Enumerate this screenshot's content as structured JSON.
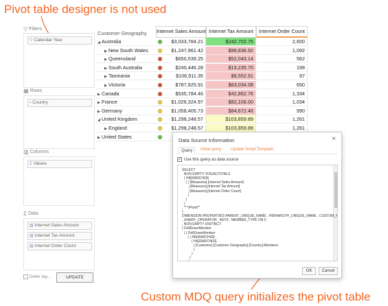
{
  "callouts": {
    "top": "Pivot table designer is not used",
    "bottom": "Custom MDQ query initializes the pivot table",
    "color": "#f26522"
  },
  "designer": {
    "filters": {
      "label": "Filters",
      "chips": [
        "Calendar Year"
      ]
    },
    "rows": {
      "label": "Rows",
      "chips": [
        "Country"
      ]
    },
    "columns": {
      "label": "Columns",
      "chips": [
        "Values"
      ]
    },
    "data": {
      "label": "Data",
      "chips": [
        "Internet Sales Amount",
        "Internet Tax Amount",
        "Internet Order Count"
      ]
    },
    "defer_label": "Defer lay...",
    "update_label": "UPDATE"
  },
  "pivot": {
    "row_header": "Customer Geography",
    "columns": [
      "Internet Sales Amount",
      "Internet Tax Amount",
      "Internet Order Count"
    ],
    "rows": [
      {
        "label": "Australia",
        "level": 0,
        "expanded": true,
        "status": "green",
        "sales": "$3,033,784.21",
        "tax": "$242,702.75",
        "orders": "2,600",
        "tax_color": "#7fe07f"
      },
      {
        "label": "New South Wales",
        "level": 1,
        "expanded": false,
        "status": "yellow",
        "sales": "$1,247,961.42",
        "tax": "$99,836.92",
        "orders": "1,092",
        "tax_color": "#f6c6c6"
      },
      {
        "label": "Queensland",
        "level": 1,
        "expanded": false,
        "status": "red",
        "sales": "$650,539.25",
        "tax": "$52,043.14",
        "orders": "562",
        "tax_color": "#f6c6c6"
      },
      {
        "label": "South Australia",
        "level": 1,
        "expanded": false,
        "status": "red",
        "sales": "$240,446.28",
        "tax": "$19,235.70",
        "orders": "199",
        "tax_color": "#f6c6c6"
      },
      {
        "label": "Tasmania",
        "level": 1,
        "expanded": false,
        "status": "red",
        "sales": "$106,911.35",
        "tax": "$8,552.91",
        "orders": "97",
        "tax_color": "#f6c6c6"
      },
      {
        "label": "Victoria",
        "level": 1,
        "expanded": false,
        "status": "red",
        "sales": "$787,925.91",
        "tax": "$63,034.08",
        "orders": "650",
        "tax_color": "#f6c6c6"
      },
      {
        "label": "Canada",
        "level": 0,
        "expanded": false,
        "status": "red",
        "sales": "$535,784.46",
        "tax": "$42,862.76",
        "orders": "1,334",
        "tax_color": "#f6c6c6"
      },
      {
        "label": "France",
        "level": 0,
        "expanded": false,
        "status": "yellow",
        "sales": "$1,026,324.97",
        "tax": "$82,106.00",
        "orders": "1,034",
        "tax_color": "#f6c6c6"
      },
      {
        "label": "Germany",
        "level": 0,
        "expanded": false,
        "status": "yellow",
        "sales": "$1,058,405.73",
        "tax": "$84,672.46",
        "orders": "990",
        "tax_color": "#f6c6c6"
      },
      {
        "label": "United Kingdom",
        "level": 0,
        "expanded": true,
        "status": "yellow",
        "sales": "$1,298,248.57",
        "tax": "$103,859.89",
        "orders": "1,261",
        "tax_color": "#fafac4"
      },
      {
        "label": "England",
        "level": 1,
        "expanded": false,
        "status": "yellow",
        "sales": "$1,298,248.57",
        "tax": "$103,859.89",
        "orders": "1,261",
        "tax_color": "#fafac4"
      },
      {
        "label": "United States",
        "level": 0,
        "expanded": false,
        "status": "green",
        "sales": "",
        "tax": "",
        "orders": "",
        "tax_color": "#ffffff"
      }
    ],
    "status_colors": {
      "green": "#6cc04a",
      "yellow": "#f2d23c",
      "red": "#e0533d"
    }
  },
  "dialog": {
    "title": "Data Source Information",
    "close_glyph": "×",
    "tabs": [
      "Query",
      "Initial query",
      "Update Script Template"
    ],
    "use_query_label": "Use this query as data source",
    "query_lines": [
      "SELECT",
      "  NON EMPTY VISUALTOTALS",
      "  ( HIERARCHIZE",
      "    ( { [Measures].[Internet Sales Amount]",
      "      , [Measures].[Internet Tax Amount]",
      "      , [Measures].[Internet Order Count]",
      "      }",
      "    )",
      "  )",
      ", \"* VPoint*\"",
      ")",
      "DIMENSION PROPERTIES PARENT_UNIQUE_NAME , HIERARCHY_UNIQUE_NAME , CUSTOM_ROLLUP",
      ", UNARY_OPERATOR , KEY0 , MEMBER_TYPE ON 0",
      ", NON EMPTY DISTINCT",
      "( DrillDownMember",
      "  ( { DrillDownMember",
      "      ( { HIERARCHIZE",
      "          ( HIERARCHIZE",
      "            ( [Customer].[Customer Geography].[Country].Members",
      "            )",
      "          )",
      "        }",
      "      }"
    ],
    "ok_label": "OK",
    "cancel_label": "Cancel"
  }
}
